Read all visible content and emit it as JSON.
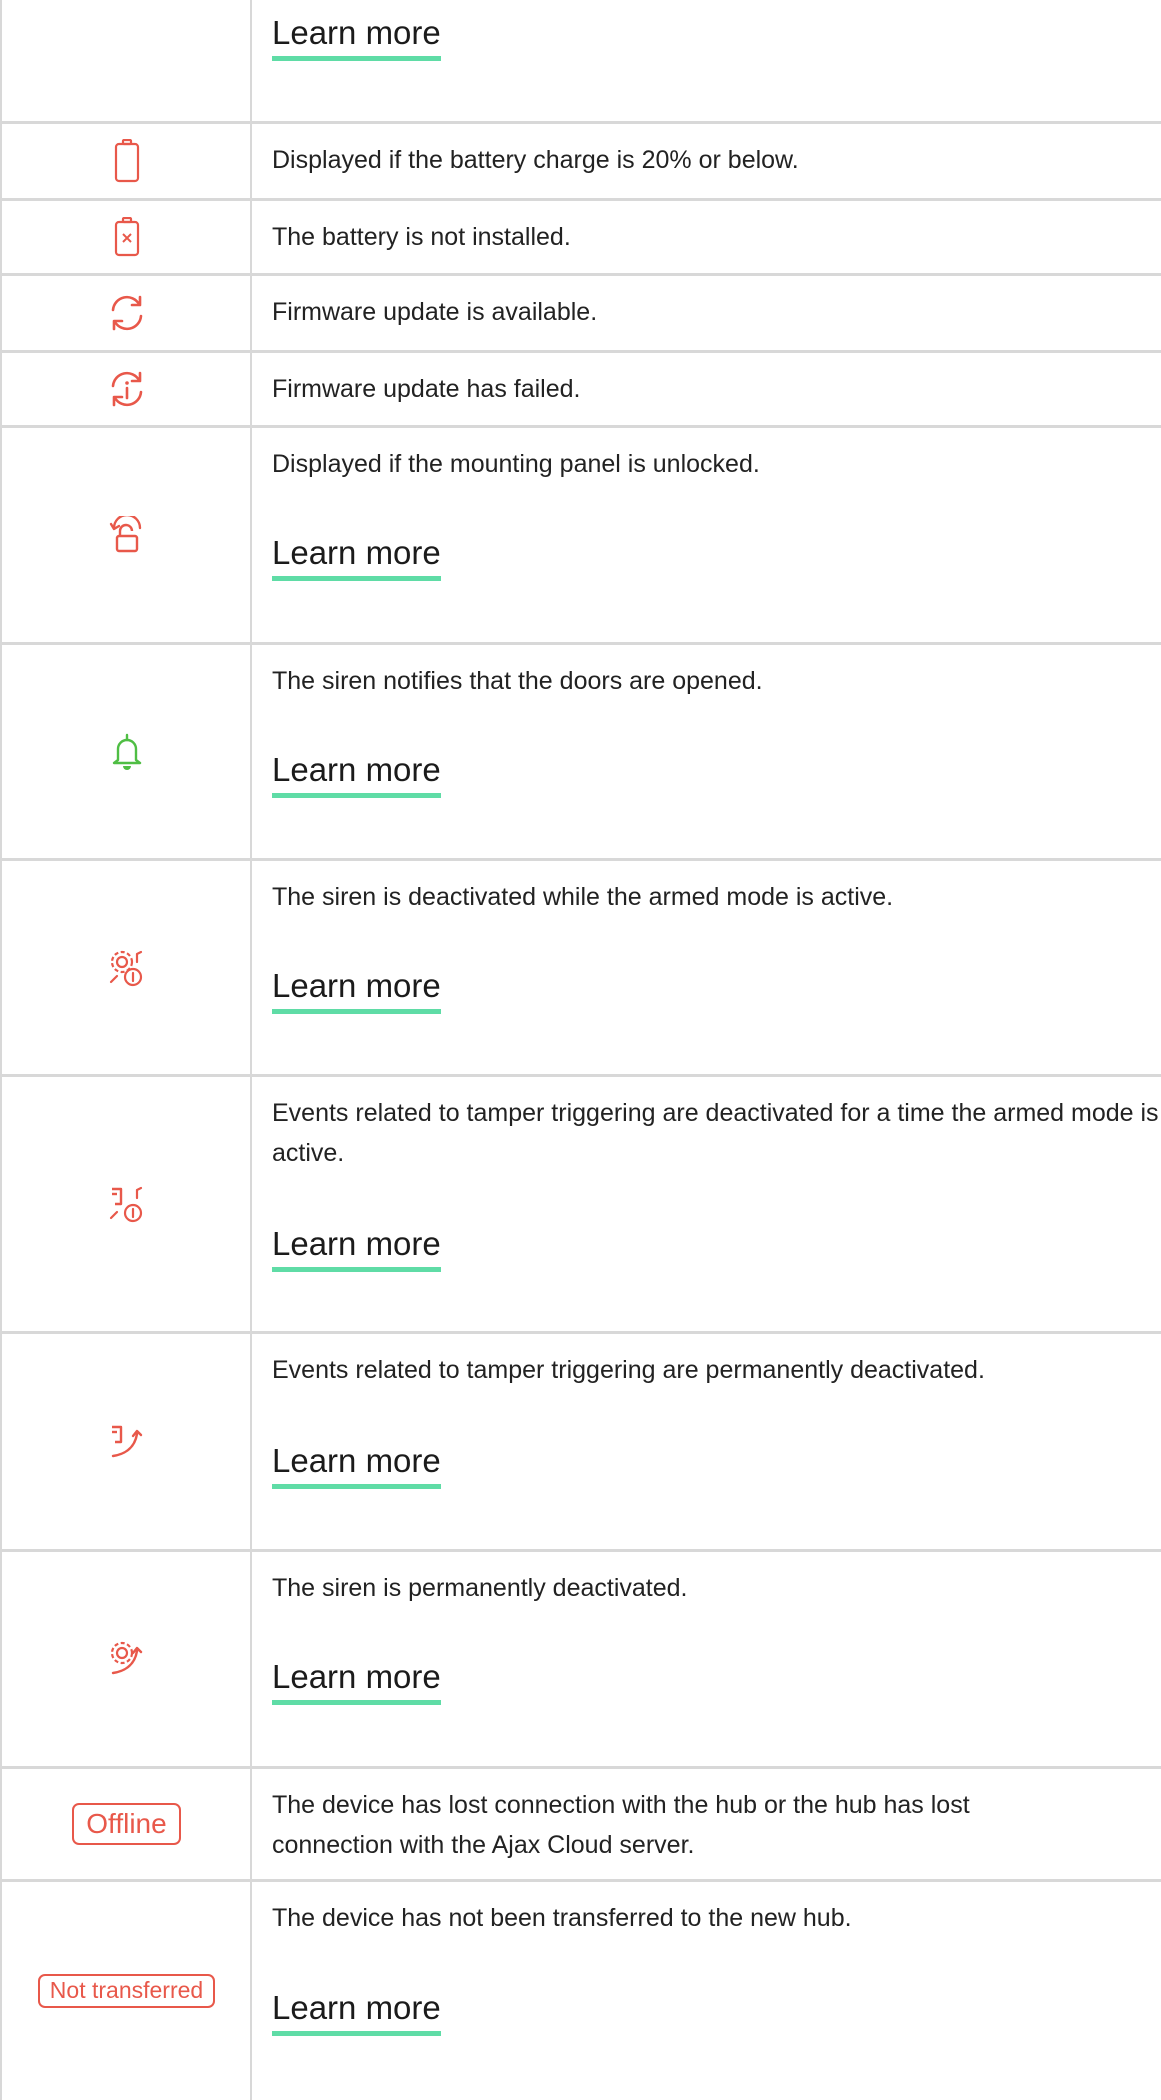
{
  "colors": {
    "icon_red": "#e8584a",
    "icon_green": "#4fbe44",
    "link_underline": "#5fdca6",
    "grid": "#d8d8d8"
  },
  "rows": [
    {
      "icon": "none",
      "text": "",
      "link": "Learn more"
    },
    {
      "icon": "battery-low-icon",
      "text": "Displayed if the battery charge is 20% or below.",
      "link": ""
    },
    {
      "icon": "battery-missing-icon",
      "text": "The battery is not installed.",
      "link": ""
    },
    {
      "icon": "firmware-update-icon",
      "text": "Firmware update is available.",
      "link": ""
    },
    {
      "icon": "firmware-update-failed-icon",
      "text": "Firmware update has failed.",
      "link": ""
    },
    {
      "icon": "unlocked-panel-icon",
      "text": "Displayed if the mounting panel is unlocked.",
      "link": "Learn more"
    },
    {
      "icon": "bell-icon",
      "text": "The siren notifies that the doors are opened.",
      "link": "Learn more"
    },
    {
      "icon": "siren-deactivated-armed-icon",
      "text": "The siren is deactivated while the armed mode is active.",
      "link": "Learn more"
    },
    {
      "icon": "tamper-deactivated-armed-icon",
      "text": "Events related to tamper triggering are deactivated for a time the armed mode is active.",
      "link": "Learn more"
    },
    {
      "icon": "tamper-deactivated-permanent-icon",
      "text": "Events related to tamper triggering are permanently deactivated.",
      "link": "Learn more"
    },
    {
      "icon": "siren-deactivated-permanent-icon",
      "text": "The siren is permanently deactivated.",
      "link": "Learn more"
    },
    {
      "icon": "offline-badge",
      "badge": "Offline",
      "text": "The device has lost connection with the hub or the hub has lost connection with the Ajax Cloud server.",
      "link": ""
    },
    {
      "icon": "not-transferred-badge",
      "badge": "Not transferred",
      "text": "The device has not been transferred to the new hub.",
      "link": "Learn more"
    }
  ]
}
